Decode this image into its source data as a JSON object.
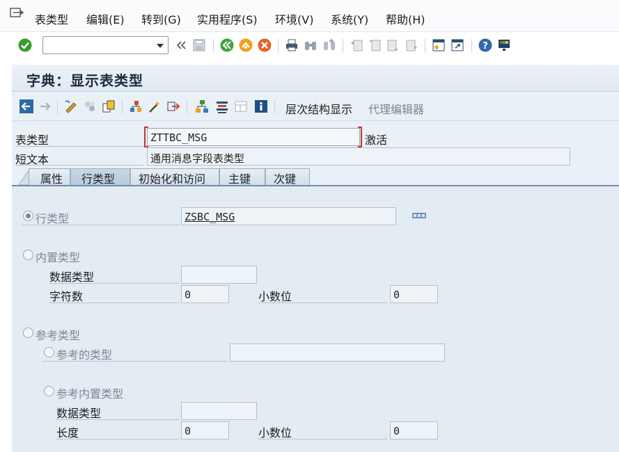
{
  "menu": {
    "items": [
      "表类型",
      "编辑(E)",
      "转到(G)",
      "实用程序(S)",
      "环境(V)",
      "系统(Y)",
      "帮助(H)"
    ]
  },
  "toolbar": {
    "command_field_value": ""
  },
  "title": "字典：显示表类型",
  "app_toolbar": {
    "hierarchy_label": "层次结构显示",
    "proxy_editor_label": "代理编辑器"
  },
  "header": {
    "table_type_label": "表类型",
    "table_type_value": "ZTTBC_MSG",
    "status": "激活",
    "short_text_label": "短文本",
    "short_text_value": "通用消息字段表类型"
  },
  "tabs": [
    {
      "label": "属性",
      "active": false
    },
    {
      "label": "行类型",
      "active": true
    },
    {
      "label": "初始化和访问",
      "active": false
    },
    {
      "label": "主键",
      "active": false
    },
    {
      "label": "次键",
      "active": false
    }
  ],
  "row_type_tab": {
    "row_type_label": "行类型",
    "row_type_value": "ZSBC_MSG",
    "builtin_type_label": "内置类型",
    "data_type_label": "数据类型",
    "data_type_value": "",
    "num_chars_label": "字符数",
    "num_chars_value": "0",
    "decimals_label": "小数位",
    "decimals_value": "0",
    "ref_type_label": "参考类型",
    "ref_to_type_label": "参考的类型",
    "ref_to_type_value": "",
    "ref_builtin_label": "参考内置类型",
    "ref_data_type_label": "数据类型",
    "ref_data_type_value": "",
    "length_label": "长度",
    "length_value": "0",
    "ref_decimals_label": "小数位",
    "ref_decimals_value": "0"
  }
}
